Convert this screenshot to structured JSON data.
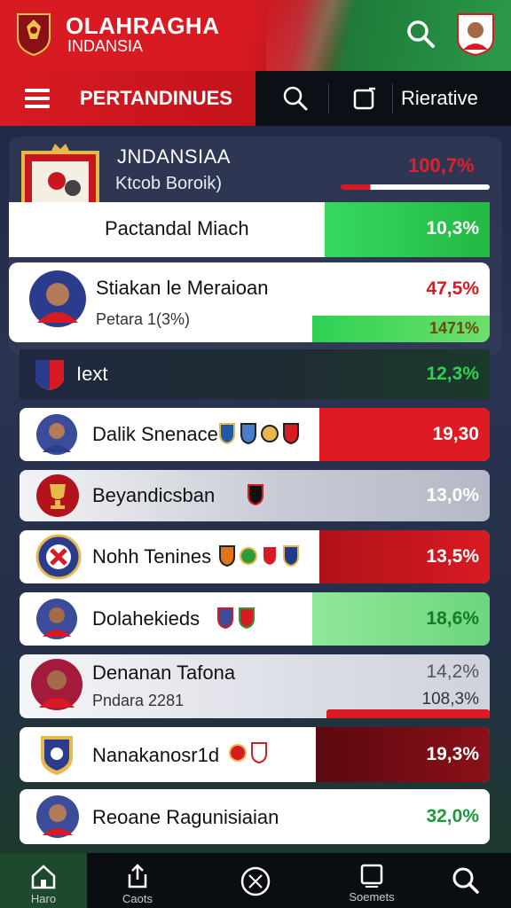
{
  "header": {
    "title": "OLAHRAGHA",
    "subtitle": "INDANSIA",
    "icons": {
      "logo": "garuda-crest",
      "search": "search-icon",
      "avatar": "player-avatar"
    }
  },
  "nav": {
    "title": "PERTANDINUES",
    "right_label": "Rierative",
    "icons": [
      "menu-icon",
      "search-icon",
      "square-icon"
    ]
  },
  "featured": {
    "team": "JNDANSIAA",
    "subtitle": "Ktcob Boroik)",
    "pct": "100,7%",
    "progress_fraction": 0.2
  },
  "rows": [
    {
      "label": "Pactandal Miach",
      "pct": "10,3%",
      "fill_color": "#2ed153",
      "pct_color": "#ffffff"
    },
    {
      "label": "Stiakan le Meraioan",
      "sub": "Petara 1(3%)",
      "pct": "47,5%",
      "pct2": "1471%",
      "pct_color": "#d81a22",
      "pct2_color": "#1a7a2e"
    },
    {
      "label": "Iext",
      "pct": "12,3%",
      "pct_color": "#2ed153"
    },
    {
      "label": "Dalik Snenace",
      "pct": "19,30",
      "fill_color": "#e01a22",
      "pct_color": "#ffffff"
    },
    {
      "label": "Beyandicsban",
      "pct": "13,0%",
      "pct_color": "#ffffff"
    },
    {
      "label": "Nohh Tenines",
      "pct": "13,5%",
      "fill_color": "#c8161f",
      "pct_color": "#ffffff"
    },
    {
      "label": "Dolahekieds",
      "pct": "18,6%",
      "fill_color": "#7fe08c",
      "pct_color": "#157a2a"
    },
    {
      "label": "Denanan Tafona",
      "sub": "Pndara 2281",
      "pct": "14,2%",
      "pct2": "108,3%",
      "pct_color": "#555555",
      "pct2_color": "#333333"
    },
    {
      "label": "Nanakanosr1d",
      "pct": "19,3%",
      "fill_color": "#7a0a14",
      "pct_color": "#ffffff"
    },
    {
      "label": "Reoane Ragunisiaian",
      "pct": "32,0%",
      "pct_color": "#1a9a3a"
    }
  ],
  "tabs": [
    {
      "label": "Haro",
      "icon": "home-icon"
    },
    {
      "label": "Caots",
      "icon": "share-icon"
    },
    {
      "label": "",
      "icon": "ball-icon"
    },
    {
      "label": "Soemets",
      "icon": "square-icon"
    },
    {
      "label": "",
      "icon": "search-icon"
    }
  ],
  "colors": {
    "red": "#d81a22",
    "green": "#2ed153",
    "dark": "#0d0f17"
  }
}
